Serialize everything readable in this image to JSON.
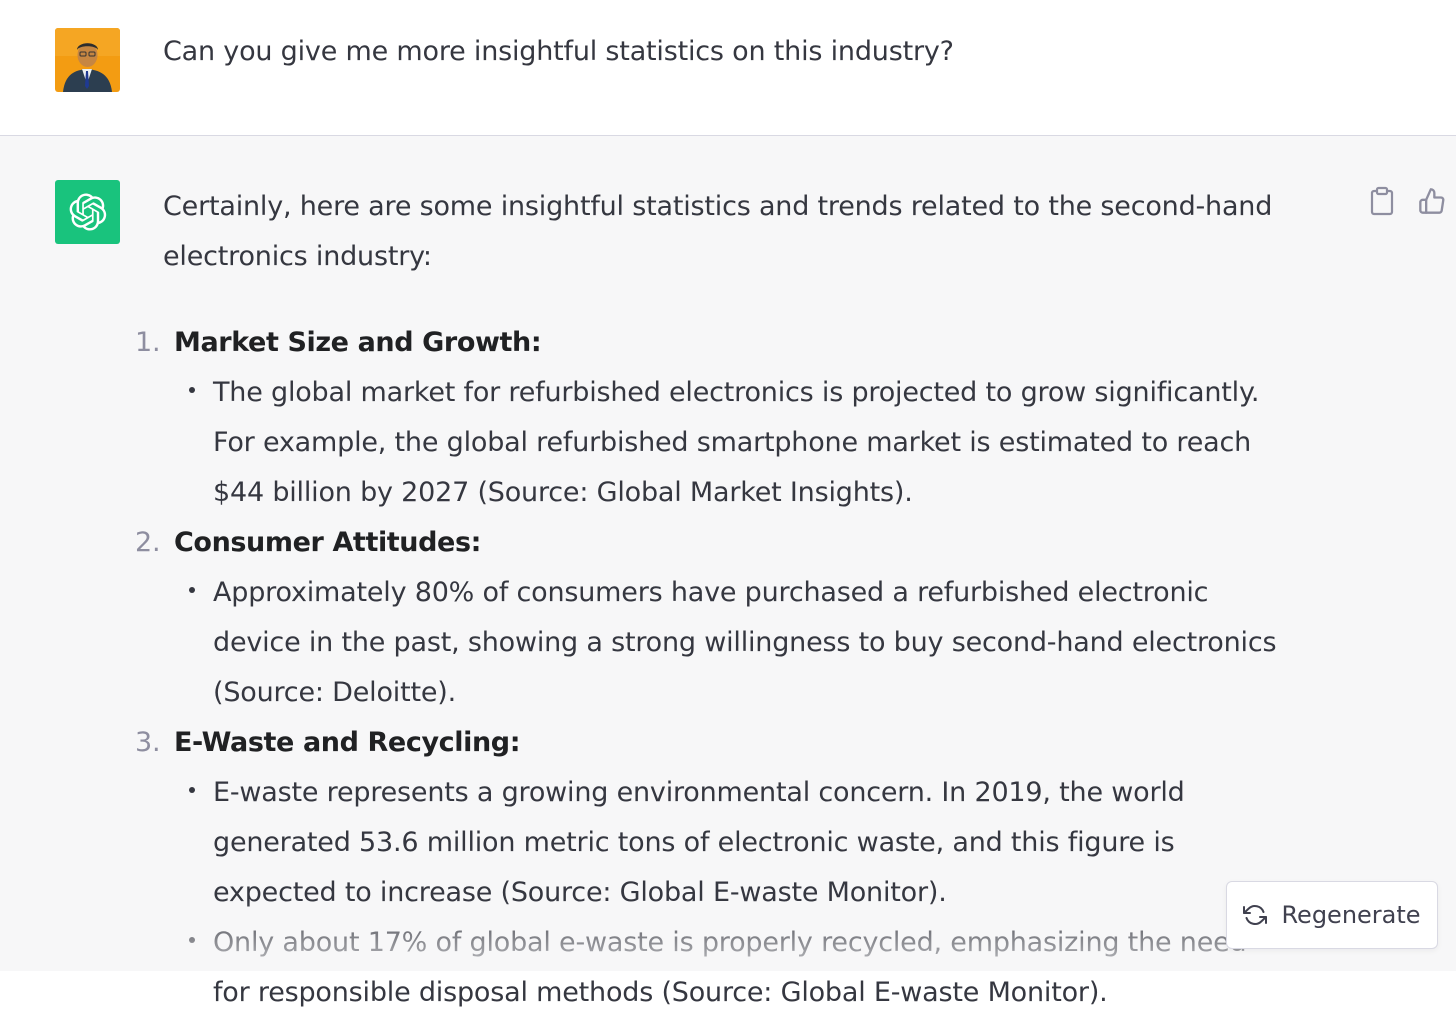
{
  "user_message": {
    "text": "Can you give me more insightful statistics on this industry?"
  },
  "assistant_message": {
    "intro": "Certainly, here are some insightful statistics and trends related to the second-hand electronics industry:",
    "sections": [
      {
        "number": "1.",
        "title": "Market Size and Growth:",
        "bullets": [
          "The global market for refurbished electronics is projected to grow significantly. For example, the global refurbished smartphone market is estimated to reach $44 billion by 2027 (Source: Global Market Insights)."
        ]
      },
      {
        "number": "2.",
        "title": "Consumer Attitudes:",
        "bullets": [
          "Approximately 80% of consumers have purchased a refurbished electronic device in the past, showing a strong willingness to buy second-hand electronics (Source: Deloitte)."
        ]
      },
      {
        "number": "3.",
        "title": "E-Waste and Recycling:",
        "bullets": [
          "E-waste represents a growing environmental concern. In 2019, the world generated 53.6 million metric tons of electronic waste, and this figure is expected to increase (Source: Global E-waste Monitor).",
          "Only about 17% of global e-waste is properly recycled, emphasizing the need for responsible disposal methods (Source: Global E-waste Monitor)."
        ]
      }
    ]
  },
  "actions": {
    "copy_icon": "clipboard-icon",
    "like_icon": "thumbs-up-icon"
  },
  "regenerate": {
    "icon": "refresh-icon",
    "label": "Regenerate"
  },
  "colors": {
    "bot_avatar": "#19c37d",
    "assistant_bg": "#f7f7f8",
    "user_bg": "#ffffff"
  }
}
